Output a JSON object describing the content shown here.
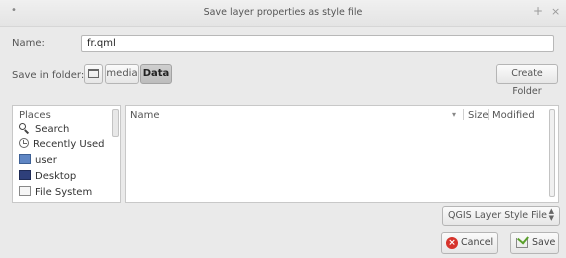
{
  "window": {
    "title": "Save layer properties as style file",
    "menu_glyph": "•",
    "plus_glyph": "+",
    "close_glyph": "×"
  },
  "name_row": {
    "label": "Name:",
    "value": "fr.qml"
  },
  "folder_row": {
    "label": "Save in folder:",
    "breadcrumbs": [
      "media",
      "Data"
    ],
    "create_folder_label": "Create Folder"
  },
  "places": {
    "header": "Places",
    "items": [
      {
        "label": "Search",
        "icon": "search-icon"
      },
      {
        "label": "Recently Used",
        "icon": "recent-icon"
      },
      {
        "label": "user",
        "icon": "home-folder-icon"
      },
      {
        "label": "Desktop",
        "icon": "desktop-icon"
      },
      {
        "label": "File System",
        "icon": "filesystem-icon"
      }
    ]
  },
  "files": {
    "columns": {
      "name": "Name",
      "size": "Size",
      "modified": "Modified"
    },
    "sort_indicator": "▾",
    "rows": []
  },
  "filter": {
    "selected": "QGIS Layer Style File",
    "arrows": "▲\n▼"
  },
  "buttons": {
    "cancel": "Cancel",
    "save": "Save",
    "cancel_icon_glyph": "×"
  }
}
